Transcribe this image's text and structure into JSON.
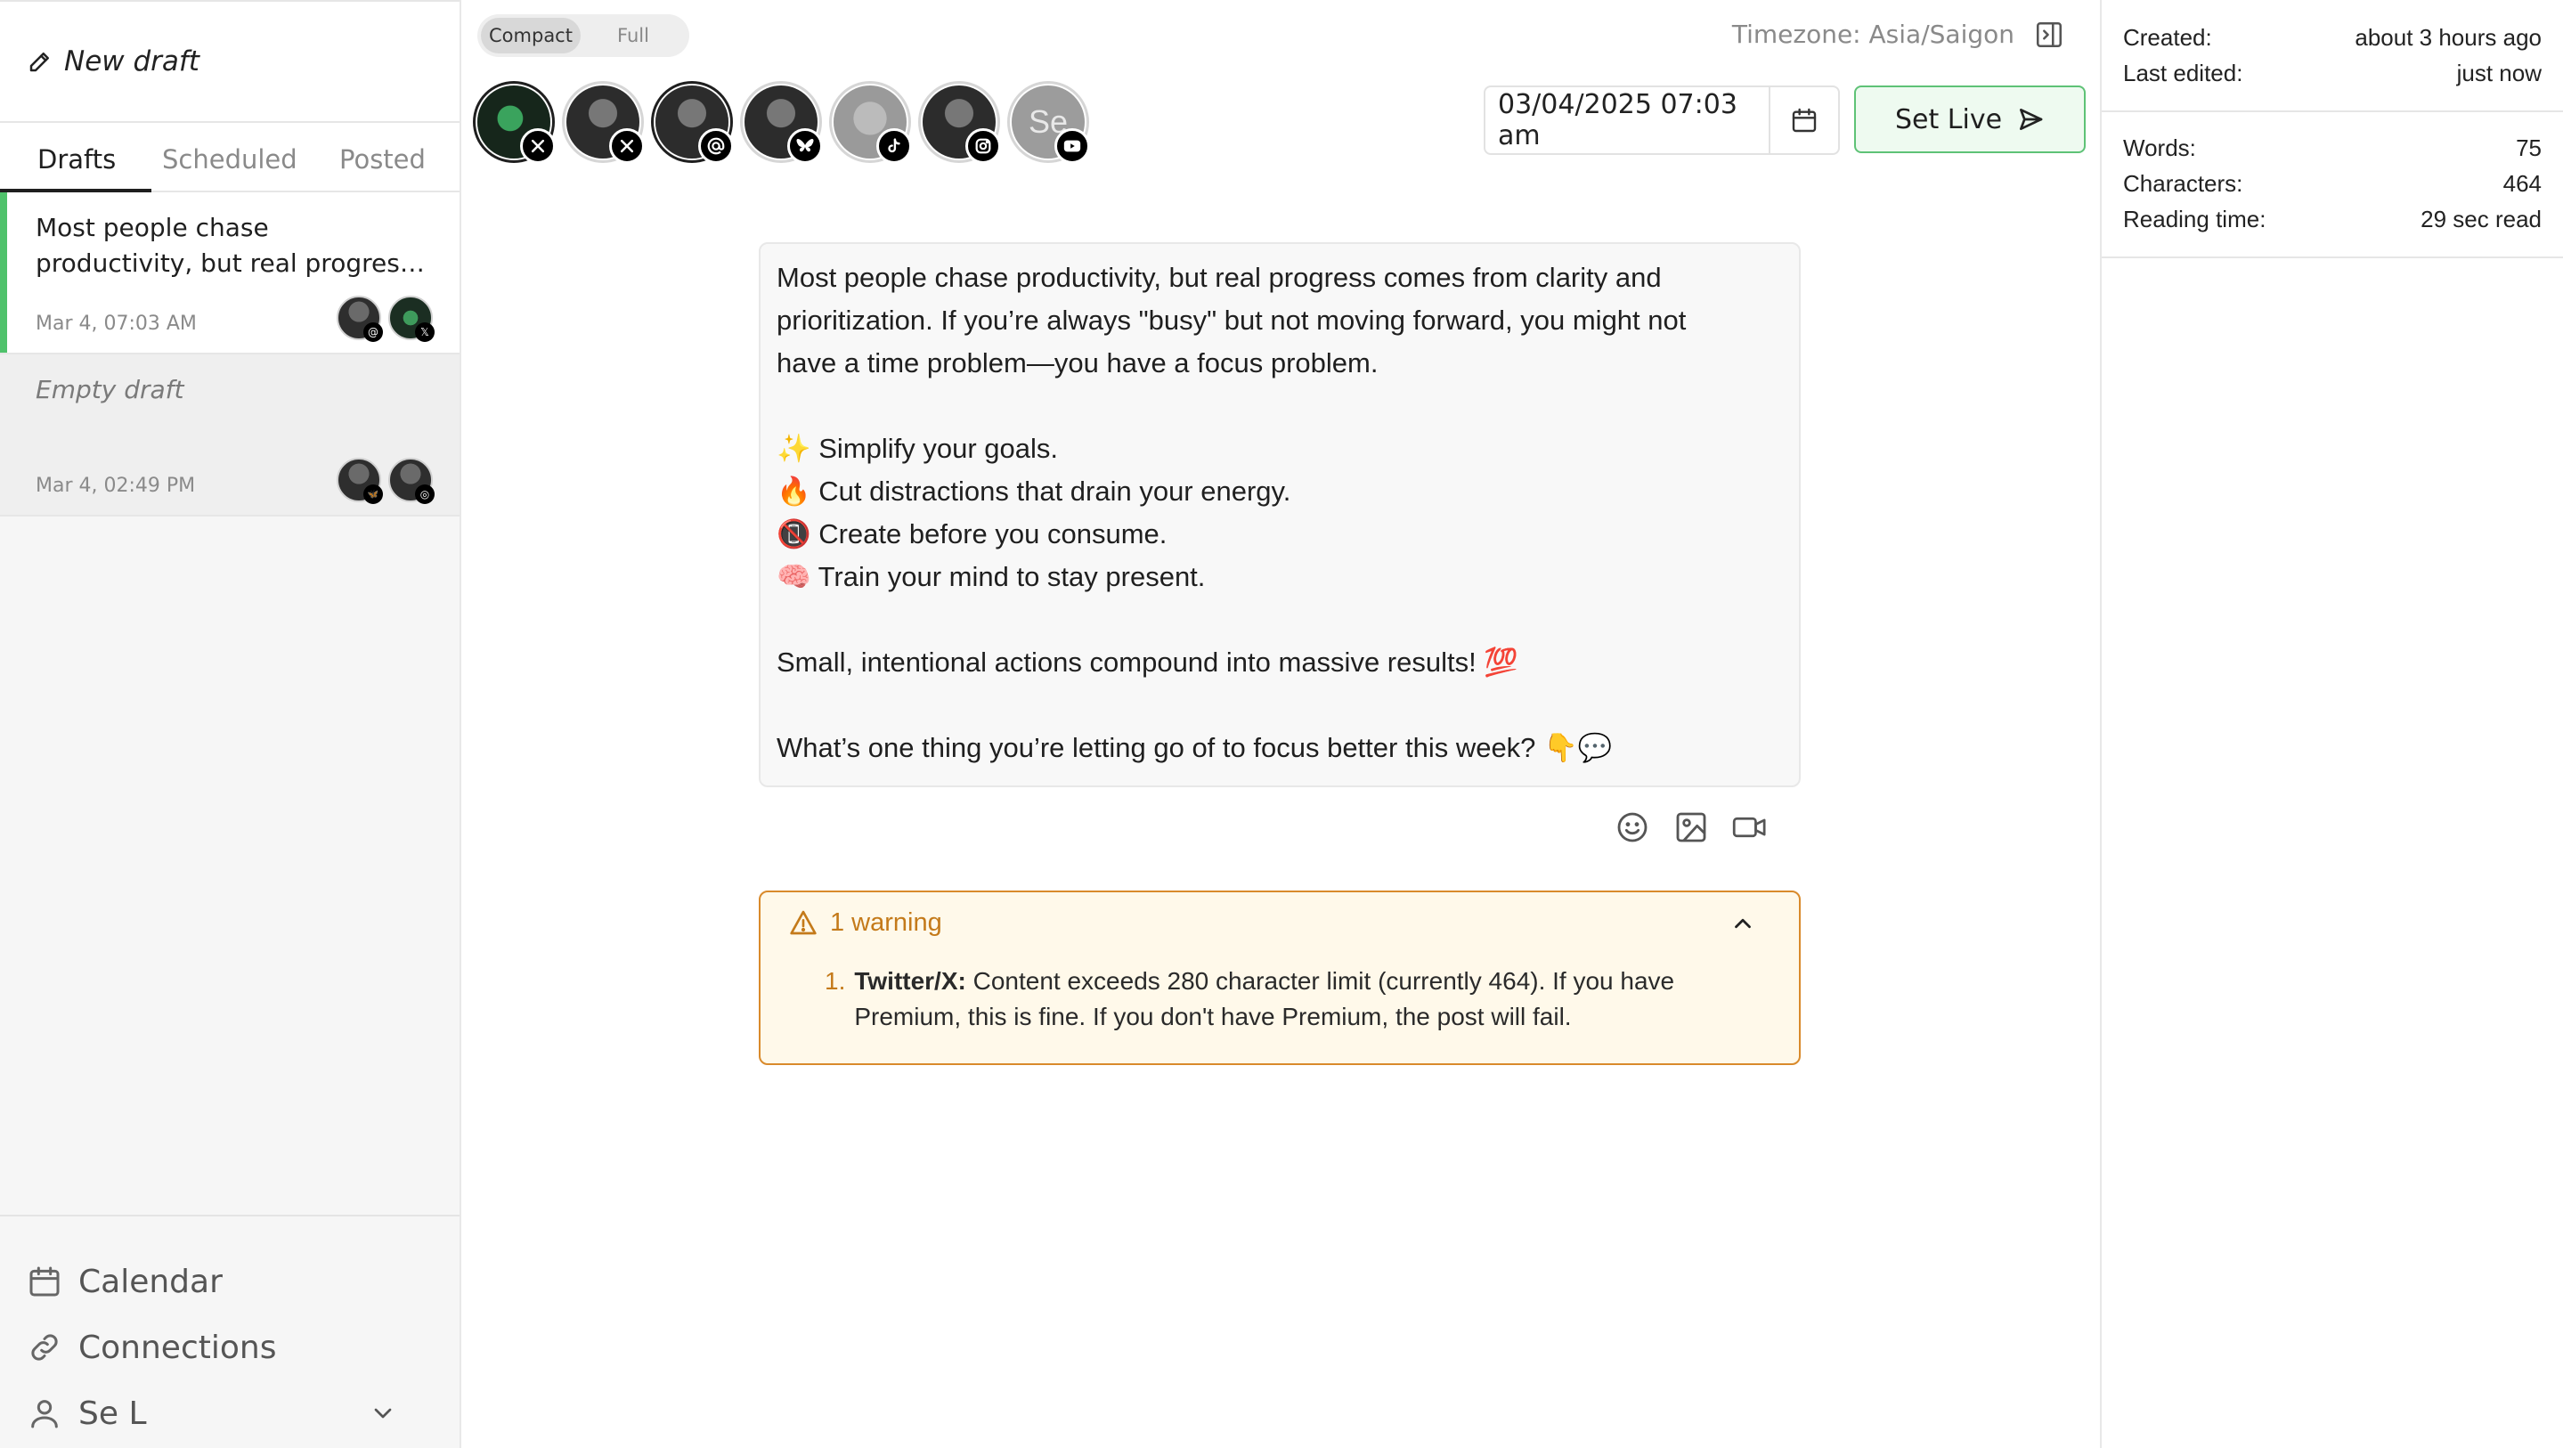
{
  "sidebar": {
    "new_draft_label": "New draft",
    "tabs": [
      {
        "label": "Drafts"
      },
      {
        "label": "Scheduled"
      },
      {
        "label": "Posted"
      }
    ],
    "drafts": [
      {
        "line1": "Most people chase",
        "line2": "productivity, but real progres…",
        "date": "Mar 4, 07:03 AM",
        "avatars": [
          {
            "platform": "threads",
            "badge": "@"
          },
          {
            "platform": "x",
            "badge": "𝕏"
          }
        ]
      },
      {
        "title": "Empty draft",
        "date": "Mar 4, 02:49 PM",
        "avatars": [
          {
            "platform": "bluesky",
            "badge": "🦋"
          },
          {
            "platform": "instagram",
            "badge": "◎"
          }
        ]
      }
    ],
    "nav": [
      {
        "label": "Calendar",
        "icon": "calendar-icon"
      },
      {
        "label": "Connections",
        "icon": "link-icon"
      },
      {
        "label": "Se L",
        "icon": "user-icon"
      }
    ]
  },
  "header": {
    "view_toggle": {
      "compact": "Compact",
      "full": "Full"
    },
    "timezone": "Timezone: Asia/Saigon",
    "datetime": "03/04/2025 07:03 am",
    "set_live_label": "Set Live"
  },
  "accounts": [
    {
      "platform": "x",
      "selected": true
    },
    {
      "platform": "x",
      "selected": false
    },
    {
      "platform": "threads",
      "selected": true
    },
    {
      "platform": "bluesky",
      "selected": false
    },
    {
      "platform": "tiktok",
      "selected": false
    },
    {
      "platform": "instagram",
      "selected": false
    },
    {
      "platform": "youtube",
      "selected": false,
      "initials": "Se"
    }
  ],
  "editor": {
    "content": "Most people chase productivity, but real progress comes from clarity and\nprioritization. If you’re always \"busy\" but not moving forward, you might not\nhave a time problem—you have a focus problem.\n\n✨ Simplify your goals.\n🔥 Cut distractions that drain your energy.\n📵 Create before you consume.\n🧠 Train your mind to stay present.\n\nSmall, intentional actions compound into massive results! 💯\n\nWhat’s one thing you’re letting go of to focus better this week? 👇💬"
  },
  "warning": {
    "title": "1 warning",
    "items": [
      {
        "num": "1.",
        "platform": "Twitter/X:",
        "message": "Content exceeds 280 character limit (currently 464). If you have Premium, this is fine. If you don't have Premium, the post will fail."
      }
    ]
  },
  "stats": {
    "created_label": "Created:",
    "created_value": "about 3 hours ago",
    "edited_label": "Last edited:",
    "edited_value": "just now",
    "words_label": "Words:",
    "words_value": "75",
    "chars_label": "Characters:",
    "chars_value": "464",
    "reading_label": "Reading time:",
    "reading_value": "29 sec read"
  },
  "colors": {
    "accent_green": "#5ec276",
    "warning_orange": "#d98a2b"
  }
}
